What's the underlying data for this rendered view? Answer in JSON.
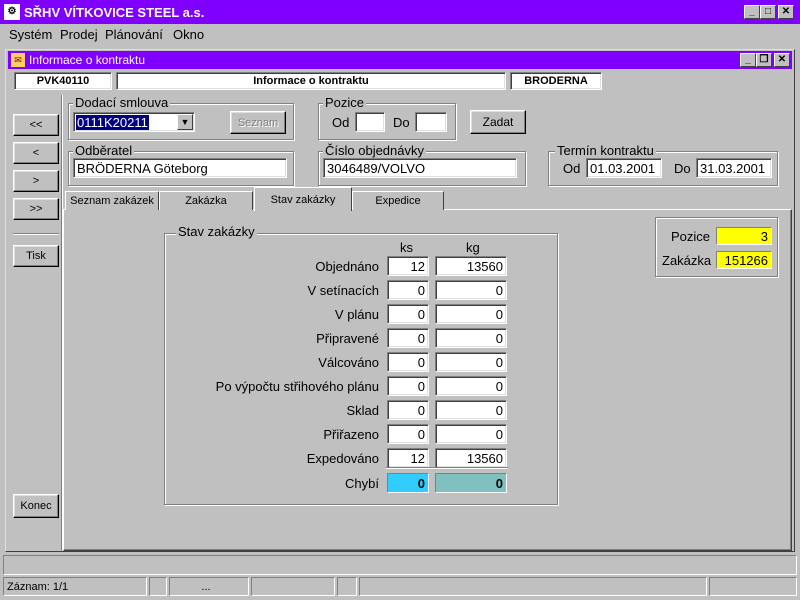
{
  "app": {
    "title": "SŘHV VÍTKOVICE STEEL a.s.",
    "menu": [
      "Systém",
      "Prodej",
      "Plánování",
      "Okno"
    ]
  },
  "window": {
    "title": "Informace o kontraktu",
    "code": "PVK40110",
    "caption": "Informace o kontraktu",
    "customer_short": "BRODERNA"
  },
  "nav": {
    "first": "<<",
    "prev": "<",
    "next": ">",
    "last": ">>",
    "print": "Tisk",
    "close": "Konec"
  },
  "form": {
    "delivery_contract_label": "Dodací smlouva",
    "delivery_contract_value": "0111K20211",
    "list_button": "Seznam",
    "position_label": "Pozice",
    "from_label": "Od",
    "to_label": "Do",
    "position_from": "",
    "position_to": "",
    "enter_button": "Zadat",
    "customer_label": "Odběratel",
    "customer_value": "BRÖDERNA Göteborg",
    "order_no_label": "Číslo objednávky",
    "order_no_value": "3046489/VOLVO",
    "term_label": "Termín kontraktu",
    "term_from": "01.03.2001",
    "term_to": "31.03.2001"
  },
  "tabs": [
    "Seznam zakázek",
    "Zakázka",
    "Stav zakázky",
    "Expedice"
  ],
  "status": {
    "group_title": "Stav zakázky",
    "col_ks": "ks",
    "col_kg": "kg",
    "rows": [
      {
        "label": "Objednáno",
        "ks": "12",
        "kg": "13560"
      },
      {
        "label": "V setínacích",
        "ks": "0",
        "kg": "0"
      },
      {
        "label": "V plánu",
        "ks": "0",
        "kg": "0"
      },
      {
        "label": "Připravené",
        "ks": "0",
        "kg": "0"
      },
      {
        "label": "Válcováno",
        "ks": "0",
        "kg": "0"
      },
      {
        "label": "Po výpočtu střihového plánu",
        "ks": "0",
        "kg": "0"
      },
      {
        "label": "Sklad",
        "ks": "0",
        "kg": "0"
      },
      {
        "label": "Přiřazeno",
        "ks": "0",
        "kg": "0"
      },
      {
        "label": "Expedováno",
        "ks": "12",
        "kg": "13560"
      }
    ],
    "missing_label": "Chybí",
    "missing_ks": "0",
    "missing_kg": "0"
  },
  "side": {
    "position_label": "Pozice",
    "position_value": "3",
    "order_label": "Zakázka",
    "order_value": "151266"
  },
  "statusbar": {
    "record": "Záznam: 1/1",
    "ellipsis": "..."
  },
  "colors": {
    "titlebar": "#8000ff",
    "highlight_yellow": "#ffff00",
    "missing_blue": "#33ccff",
    "missing_teal": "#80c0c0"
  }
}
